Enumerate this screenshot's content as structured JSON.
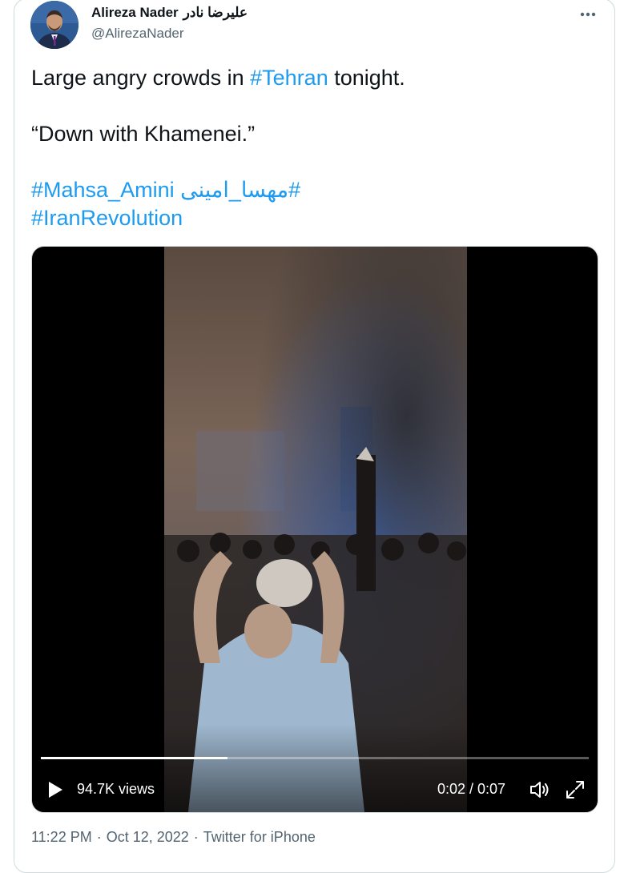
{
  "author": {
    "display_name": "Alireza Nader",
    "display_name_fa": "علیرضا نادر",
    "handle": "@AlirezaNader"
  },
  "tweet": {
    "line1_pre": "Large angry crowds in ",
    "line1_tag": "#Tehran",
    "line1_post": " tonight.",
    "quote": "“Down with Khamenei.”",
    "tag_mahsa": "#Mahsa_Amini",
    "tag_mahsa_fa": "#مهسا_امینی",
    "tag_revolution": "#IranRevolution"
  },
  "video": {
    "views": "94.7K views",
    "time": "0:02 / 0:07",
    "progress": 0.34
  },
  "meta": {
    "time": "11:22 PM",
    "date": "Oct 12, 2022",
    "source": "Twitter for iPhone",
    "sep": "·"
  },
  "colors": {
    "link": "#1d9bf0",
    "muted": "#536471",
    "text": "#0f1419"
  },
  "icons": [
    "more-icon",
    "play-icon",
    "volume-icon",
    "fullscreen-icon"
  ]
}
